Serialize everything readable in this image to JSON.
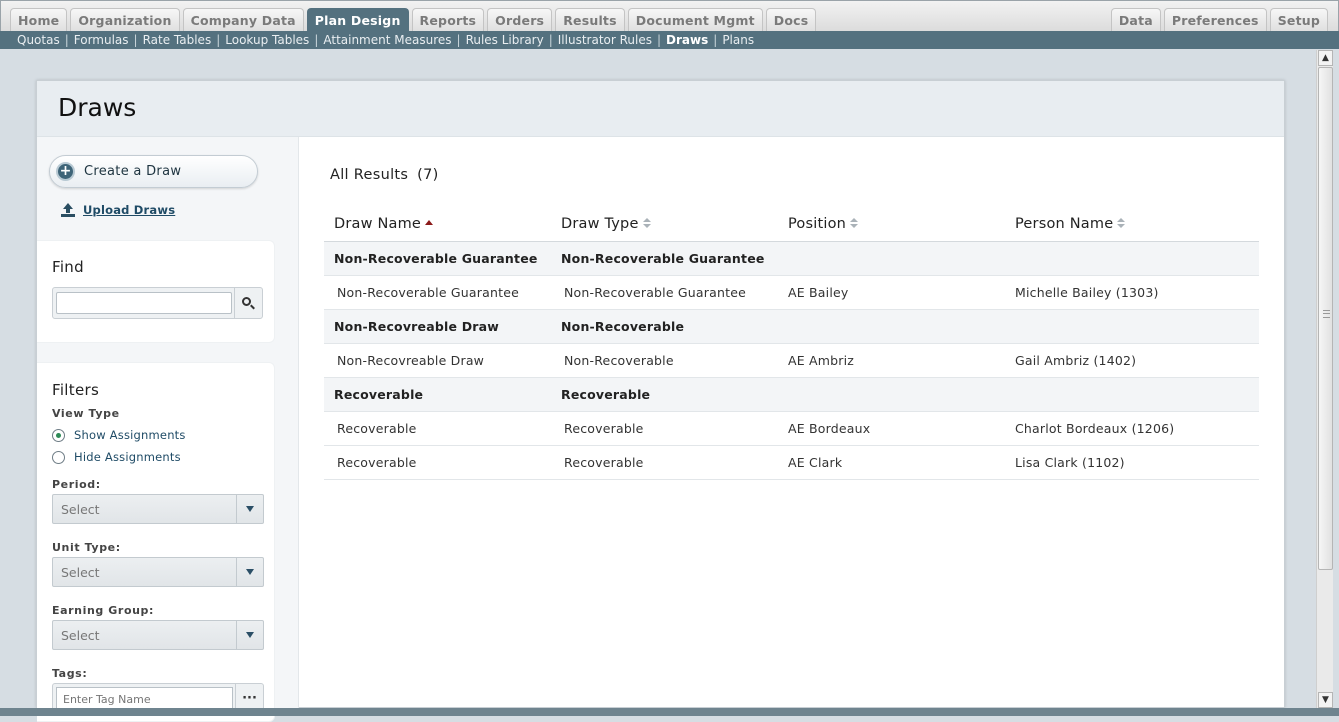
{
  "topnav": {
    "left_tabs": [
      {
        "label": "Home"
      },
      {
        "label": "Organization"
      },
      {
        "label": "Company Data"
      },
      {
        "label": "Plan Design",
        "active": true
      },
      {
        "label": "Reports"
      },
      {
        "label": "Orders"
      },
      {
        "label": "Results"
      },
      {
        "label": "Document Mgmt"
      },
      {
        "label": "Docs"
      }
    ],
    "right_tabs": [
      {
        "label": "Data"
      },
      {
        "label": "Preferences"
      },
      {
        "label": "Setup"
      }
    ]
  },
  "subnav": {
    "items": [
      {
        "label": "Quotas"
      },
      {
        "label": "Formulas"
      },
      {
        "label": "Rate Tables"
      },
      {
        "label": "Lookup Tables"
      },
      {
        "label": "Attainment Measures"
      },
      {
        "label": "Rules Library"
      },
      {
        "label": "Illustrator Rules"
      },
      {
        "label": "Draws",
        "active": true
      },
      {
        "label": "Plans"
      }
    ]
  },
  "page": {
    "title": "Draws"
  },
  "sidebar": {
    "create_label": "Create a Draw",
    "upload_label": "Upload Draws",
    "find": {
      "title": "Find",
      "value": "",
      "placeholder": ""
    },
    "filters": {
      "title": "Filters",
      "view_type_label": "View Type",
      "show_assignments": "Show Assignments",
      "hide_assignments": "Hide Assignments",
      "period_label": "Period:",
      "period_value": "Select",
      "unit_type_label": "Unit Type:",
      "unit_type_value": "Select",
      "earning_group_label": "Earning Group:",
      "earning_group_value": "Select",
      "tags_label": "Tags:",
      "tags_placeholder": "Enter Tag Name",
      "tags_button": "···"
    }
  },
  "results": {
    "title": "All Results",
    "count": "(7)",
    "columns": [
      "Draw Name",
      "Draw Type",
      "Position",
      "Person Name"
    ],
    "rows": [
      {
        "kind": "group",
        "cells": [
          "Non-Recoverable Guarantee",
          "Non-Recoverable Guarantee",
          "",
          ""
        ]
      },
      {
        "kind": "child",
        "cells": [
          "Non-Recoverable Guarantee",
          "Non-Recoverable Guarantee",
          "AE Bailey",
          "Michelle Bailey (1303)"
        ]
      },
      {
        "kind": "group",
        "cells": [
          "Non-Recovreable Draw",
          "Non-Recoverable",
          "",
          ""
        ]
      },
      {
        "kind": "child",
        "cells": [
          "Non-Recovreable Draw",
          "Non-Recoverable",
          "AE Ambriz",
          "Gail Ambriz (1402)"
        ]
      },
      {
        "kind": "group",
        "cells": [
          "Recoverable",
          "Recoverable",
          "",
          ""
        ]
      },
      {
        "kind": "child",
        "cells": [
          "Recoverable",
          "Recoverable",
          "AE Bordeaux",
          "Charlot Bordeaux (1206)"
        ]
      },
      {
        "kind": "child",
        "cells": [
          "Recoverable",
          "Recoverable",
          "AE Clark",
          "Lisa Clark (1102)"
        ]
      }
    ]
  },
  "colors": {
    "nav_active": "#54717f",
    "link": "#1f4b66",
    "sort_indicator": "#8b1a1a"
  }
}
